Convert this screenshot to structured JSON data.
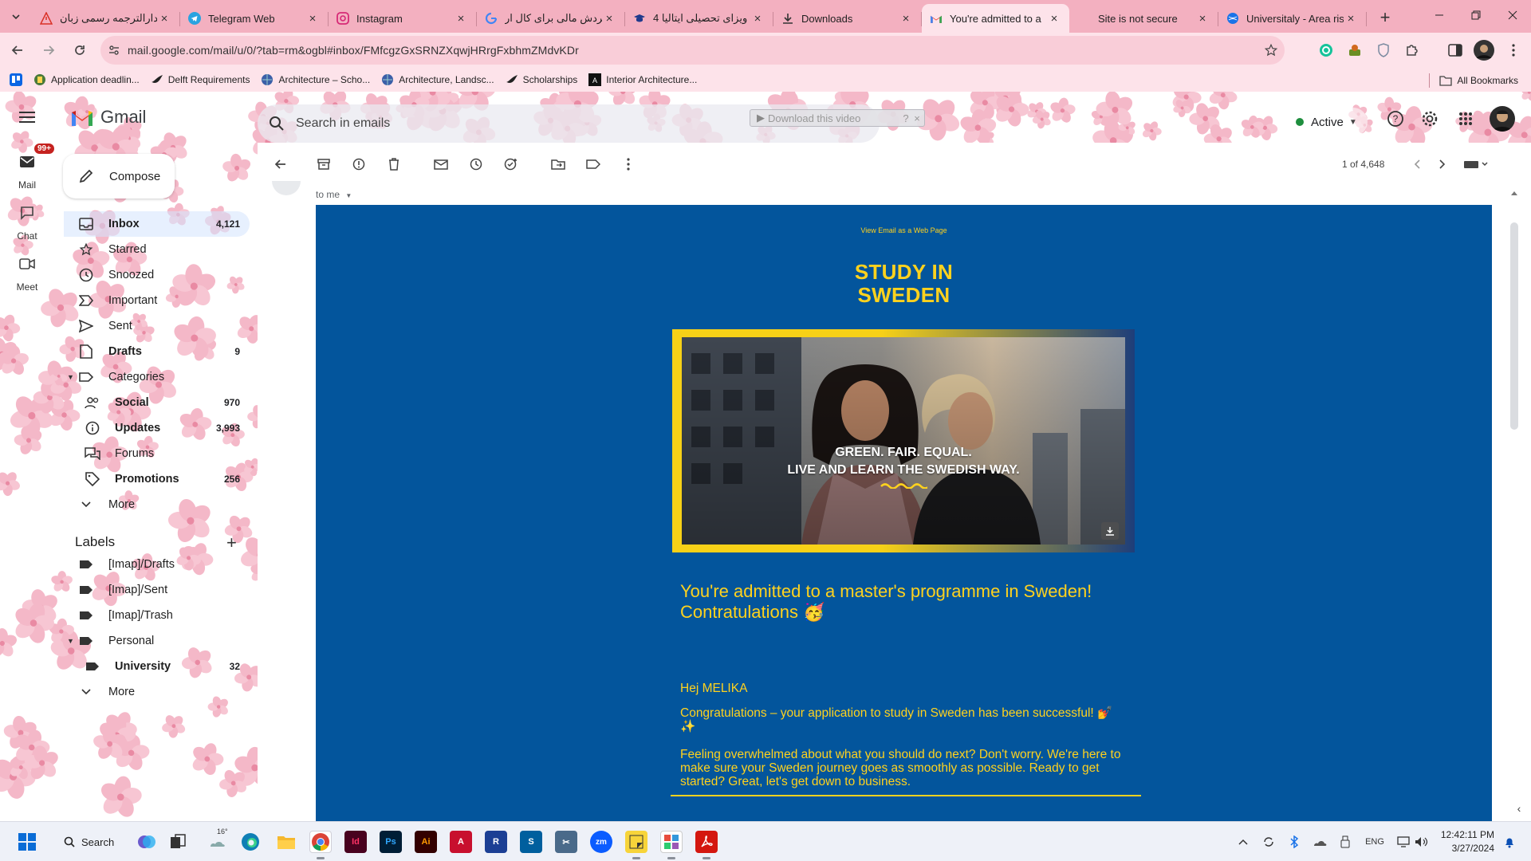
{
  "browser": {
    "tabs": [
      {
        "title": "دارالترجمه رسمی زبان",
        "icon": "warning-icon",
        "active": false
      },
      {
        "title": "Telegram Web",
        "icon": "telegram-icon",
        "active": false
      },
      {
        "title": "Instagram",
        "icon": "instagram-icon",
        "active": false
      },
      {
        "title": "گردش مالی برای کال ار",
        "icon": "google-icon",
        "active": false
      },
      {
        "title": "ویزای تحصیلی ایتالیا 4",
        "icon": "graduation-cap-icon",
        "active": false
      },
      {
        "title": "Downloads",
        "icon": "download-icon",
        "active": false
      },
      {
        "title": "You're admitted to a",
        "icon": "gmail-icon",
        "active": true
      },
      {
        "title": "Site is not secure",
        "icon": "",
        "active": false
      },
      {
        "title": "Universitaly - Area ris",
        "icon": "globe-icon",
        "active": false
      }
    ],
    "url": "mail.google.com/mail/u/0/?tab=rm&ogbl#inbox/FMfcgzGxSRNZXqwjHRrgFxbhmZMdvKDr",
    "bookmarks": [
      {
        "label": "Application deadlin...",
        "icon": "bookmark-icon"
      },
      {
        "label": "Delft Requirements",
        "icon": "bird-icon"
      },
      {
        "label": "Architecture – Scho...",
        "icon": "globe-icon"
      },
      {
        "label": "Architecture, Landsc...",
        "icon": "globe-icon"
      },
      {
        "label": "Scholarships",
        "icon": "bird-icon"
      },
      {
        "label": "Interior Architecture...",
        "icon": "arch-icon"
      }
    ],
    "all_bookmarks": "All Bookmarks"
  },
  "gmail": {
    "brand": "Gmail",
    "search_placeholder": "Search in emails",
    "download_video": "Download this video",
    "status": "Active",
    "rail": [
      {
        "label": "Mail",
        "badge": "99+"
      },
      {
        "label": "Chat"
      },
      {
        "label": "Meet"
      }
    ],
    "compose": "Compose",
    "nav": [
      {
        "label": "Inbox",
        "count": "4,121",
        "bold": true,
        "selected": true,
        "icon": "inbox-icon"
      },
      {
        "label": "Starred",
        "count": "",
        "bold": false,
        "icon": "star-icon"
      },
      {
        "label": "Snoozed",
        "count": "",
        "bold": false,
        "icon": "clock-icon"
      },
      {
        "label": "Important",
        "count": "",
        "bold": false,
        "icon": "important-icon"
      },
      {
        "label": "Sent",
        "count": "",
        "bold": false,
        "icon": "send-icon"
      },
      {
        "label": "Drafts",
        "count": "9",
        "bold": true,
        "icon": "draft-icon"
      },
      {
        "label": "Categories",
        "count": "",
        "bold": false,
        "icon": "label-icon",
        "caret": true
      },
      {
        "label": "Social",
        "count": "970",
        "bold": true,
        "icon": "people-icon",
        "sub": true
      },
      {
        "label": "Updates",
        "count": "3,993",
        "bold": true,
        "icon": "info-icon",
        "sub": true
      },
      {
        "label": "Forums",
        "count": "",
        "bold": false,
        "icon": "forum-icon",
        "sub": true
      },
      {
        "label": "Promotions",
        "count": "256",
        "bold": true,
        "icon": "tag-icon",
        "sub": true
      },
      {
        "label": "More",
        "count": "",
        "bold": false,
        "icon": "chevron-down-icon",
        "sub": false
      }
    ],
    "labels_title": "Labels",
    "labels": [
      {
        "label": "[Imap]/Drafts",
        "count": "",
        "bold": false
      },
      {
        "label": "[Imap]/Sent",
        "count": "",
        "bold": false
      },
      {
        "label": "[Imap]/Trash",
        "count": "",
        "bold": false
      },
      {
        "label": "Personal",
        "count": "",
        "bold": false,
        "caret": true
      },
      {
        "label": "University",
        "count": "32",
        "bold": true,
        "sub": true
      },
      {
        "label": "More",
        "count": "",
        "bold": false,
        "icon": "chevron-down-icon"
      }
    ],
    "pager": "1 of 4,648",
    "to_me": "to me"
  },
  "email": {
    "view_web": "View Email as a Web Page",
    "header_line1": "STUDY IN",
    "header_line2": "SWEDEN",
    "hero_line1": "GREEN. FAIR. EQUAL.",
    "hero_line2": "LIVE AND LEARN THE SWEDISH WAY.",
    "headline": "You're admitted to a master's programme in Sweden! Contratulations 🥳",
    "greeting": "Hej MELIKA",
    "p1": "Congratulations – your application to study in Sweden has been successful! 💅 ✨",
    "p2": "Feeling overwhelmed about what you should do next? Don't worry. We're here to make sure your Sweden journey goes as smoothly as possible. Ready to get started? Great, let's get down to business.",
    "colors": {
      "background": "#03559c",
      "text": "#ffd21e"
    }
  },
  "taskbar": {
    "search": "Search",
    "weather": "16°",
    "lang": "ENG",
    "time": "12:42:11 PM",
    "date": "3/27/2024"
  }
}
